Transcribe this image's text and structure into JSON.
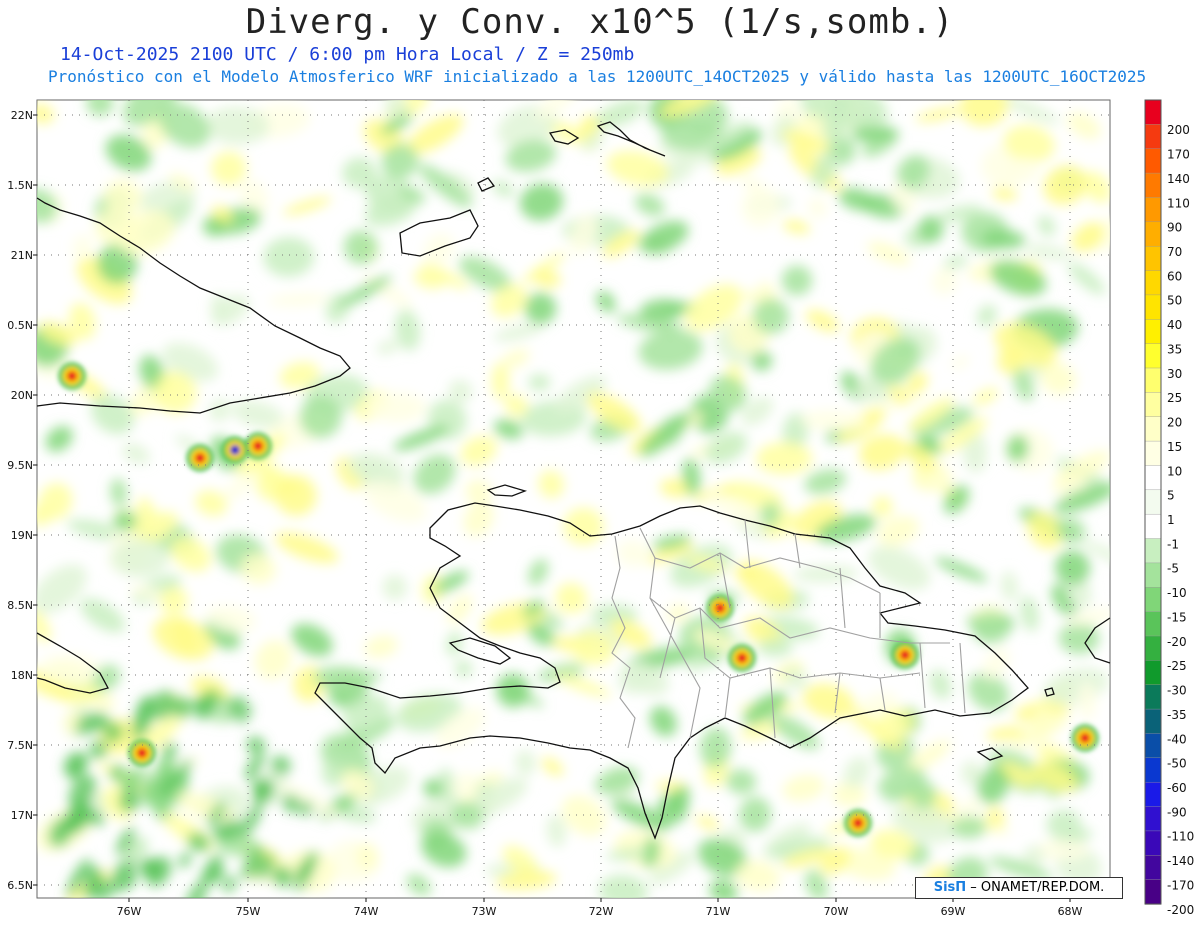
{
  "title": "Diverg. y Conv. x10^5 (1/s,somb.)",
  "subtitle_line1": "14-Oct-2025  2100 UTC / 6:00 pm Hora Local / Z = 250mb",
  "subtitle_line2": "Pronóstico con el Modelo Atmosferico WRF inicializado a las 1200UTC_14OCT2025 y válido hasta las  1200UTC_16OCT2025",
  "latitude_labels": [
    "22N",
    "1.5N",
    "21N",
    "0.5N",
    "20N",
    "9.5N",
    "19N",
    "8.5N",
    "18N",
    "7.5N",
    "17N",
    "6.5N"
  ],
  "longitude_labels": [
    "76W",
    "75W",
    "74W",
    "73W",
    "72W",
    "71W",
    "70W",
    "69W",
    "68W"
  ],
  "colorbar": {
    "labels": [
      "200",
      "170",
      "140",
      "110",
      "90",
      "70",
      "60",
      "50",
      "40",
      "35",
      "30",
      "25",
      "20",
      "15",
      "10",
      "5",
      "1",
      "-1",
      "-5",
      "-10",
      "-15",
      "-20",
      "-25",
      "-30",
      "-35",
      "-40",
      "-50",
      "-60",
      "-90",
      "-110",
      "-140",
      "-170",
      "-200"
    ],
    "colors": [
      "#e8001e",
      "#f53a10",
      "#ff5a00",
      "#ff7a00",
      "#ff9900",
      "#ffae00",
      "#ffc400",
      "#ffd800",
      "#ffe400",
      "#fff000",
      "#ffff2e",
      "#ffff6e",
      "#ffffa0",
      "#ffffc8",
      "#ffffe4",
      "#ffffff",
      "#f3fbef",
      "#ffffff",
      "#c8efc0",
      "#a4e39c",
      "#80d678",
      "#5ac45a",
      "#34b040",
      "#109a2c",
      "#0b7a5a",
      "#0a6278",
      "#0a4ea8",
      "#0a38d0",
      "#1a1ae8",
      "#3010d0",
      "#3a08b8",
      "#42069e",
      "#480086"
    ]
  },
  "credit": {
    "logo": "SisΠ",
    "text": " – ONAMET/REP.DOM."
  },
  "hotspot_colors": {
    "positive": "#e8001e",
    "positive_core": "#ffd800",
    "negative": "#1010d0"
  }
}
